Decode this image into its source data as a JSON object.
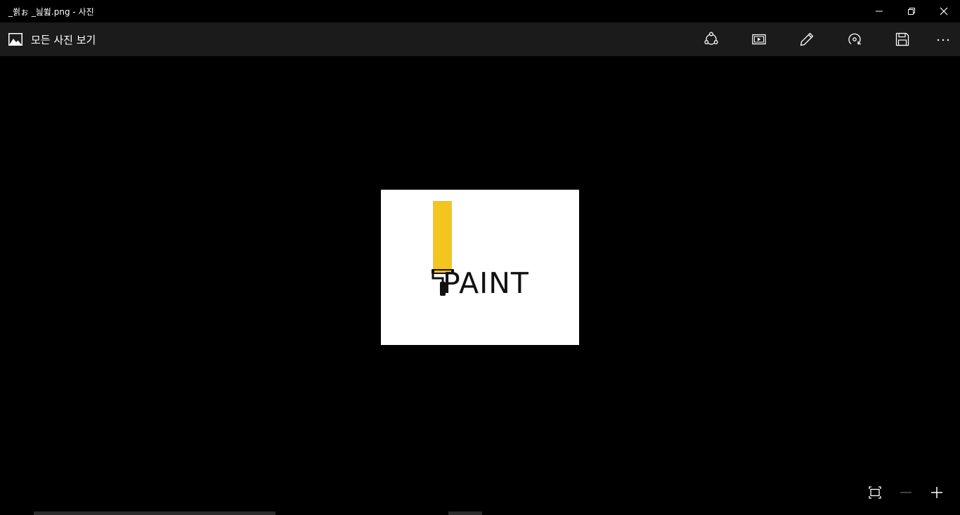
{
  "window": {
    "title": "_쐵ぉ _늺쓆.png - 사진"
  },
  "toolbar": {
    "back_label": "모든 사진 보기",
    "buttons": [
      {
        "icon": "share-icon"
      },
      {
        "icon": "slideshow-icon"
      },
      {
        "icon": "edit-pencil-icon"
      },
      {
        "icon": "rotate-icon"
      },
      {
        "icon": "save-icon"
      },
      {
        "icon": "more-icon"
      }
    ]
  },
  "photo": {
    "logo_text": "PAINT",
    "accent_color": "#f3c61f",
    "background": "#ffffff"
  },
  "zoom_controls": [
    {
      "icon": "fit-to-window-icon"
    },
    {
      "icon": "zoom-out-icon"
    },
    {
      "icon": "zoom-in-icon"
    }
  ],
  "colors": {
    "app_background": "#000000",
    "toolbar_background": "#1b1b1b"
  }
}
